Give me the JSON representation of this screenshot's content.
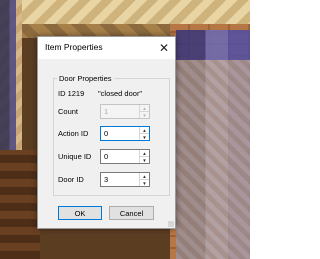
{
  "dialog": {
    "title": "Item Properties",
    "close_glyph": "✕",
    "group_title": "Door Properties",
    "id_text": "ID 1219",
    "name_text": "\"closed door\"",
    "fields": {
      "count": {
        "label": "Count",
        "value": "1"
      },
      "action_id": {
        "label": "Action ID",
        "value": "0"
      },
      "unique_id": {
        "label": "Unique ID",
        "value": "0"
      },
      "door_id": {
        "label": "Door ID",
        "value": "3"
      }
    },
    "buttons": {
      "ok": "OK",
      "cancel": "Cancel"
    }
  },
  "colors": {
    "dialog_bg": "#f0f0f0",
    "focus_accent": "#0078d7"
  },
  "icons": {
    "close": "close-icon",
    "spin_up": "chevron-up-icon",
    "spin_down": "chevron-down-icon",
    "resize": "resize-grip-icon"
  }
}
